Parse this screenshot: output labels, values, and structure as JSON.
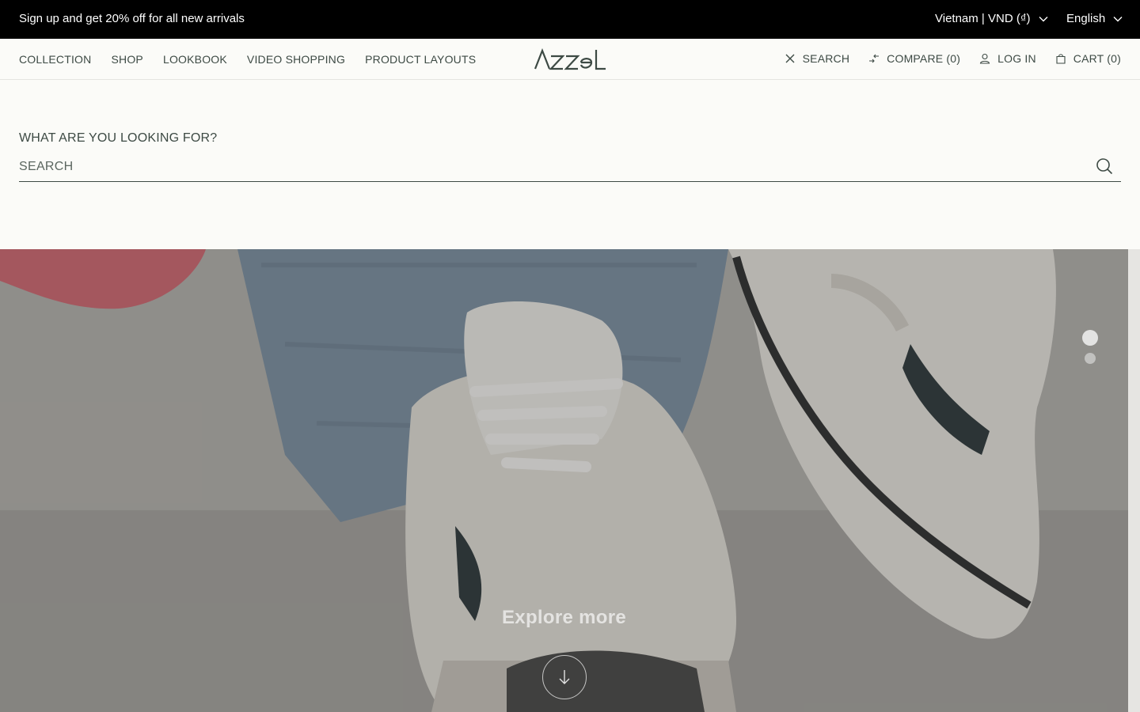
{
  "announcement": {
    "text": "Sign up and get 20% off for all new arrivals",
    "country_currency": "Vietnam | VND (₫)",
    "language": "English"
  },
  "header": {
    "nav": [
      "COLLECTION",
      "SHOP",
      "LOOKBOOK",
      "VIDEO SHOPPING",
      "PRODUCT LAYOUTS"
    ],
    "logo": "AZZEL",
    "actions": {
      "search": "SEARCH",
      "compare": "COMPARE (0)",
      "login": "LOG IN",
      "cart": "CART (0)"
    }
  },
  "search": {
    "heading": "WHAT ARE YOU LOOKING FOR?",
    "placeholder": "SEARCH",
    "value": ""
  },
  "hero": {
    "cta": "Explore more",
    "slides_total": 2,
    "active_slide": 1
  },
  "colors": {
    "topbar_bg": "#000000",
    "page_bg": "#fbfbf8",
    "text": "#3d4a44"
  }
}
